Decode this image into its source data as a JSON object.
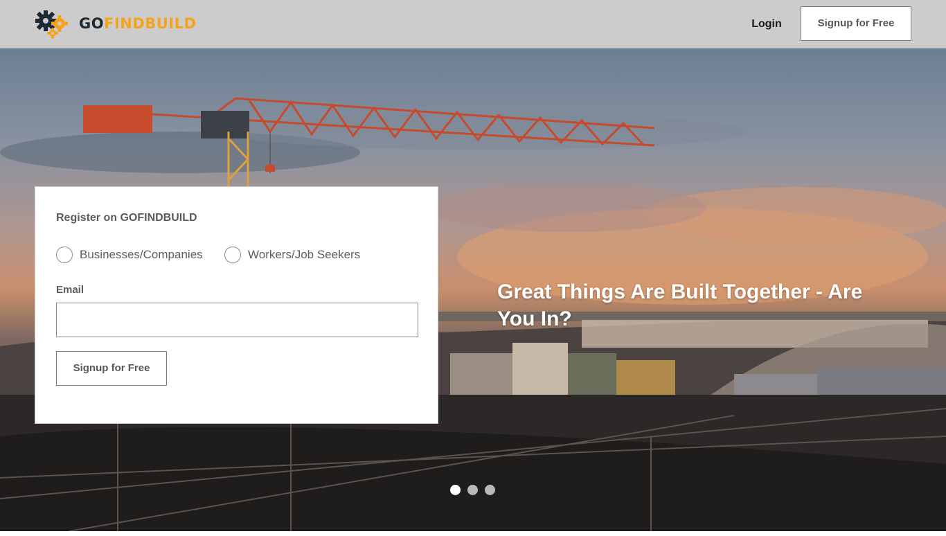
{
  "header": {
    "logo_icon": "gears-icon",
    "logo_text_go": "GO",
    "logo_text_rest": "FINDBUILD",
    "login_label": "Login",
    "signup_label": "Signup for Free"
  },
  "hero": {
    "title": "Great Things Are Built Together - Are You In?",
    "carousel_dots": 3,
    "active_dot": 1
  },
  "register": {
    "title": "Register on GOFINDBUILD",
    "options": [
      {
        "label": "Businesses/Companies",
        "selected": false
      },
      {
        "label": "Workers/Job Seekers",
        "selected": false
      }
    ],
    "email_label": "Email",
    "email_value": "",
    "signup_label": "Signup for Free"
  },
  "colors": {
    "brand_orange": "#f7a21b",
    "brand_dark": "#1e2a33",
    "header_bg": "#cccccc"
  }
}
